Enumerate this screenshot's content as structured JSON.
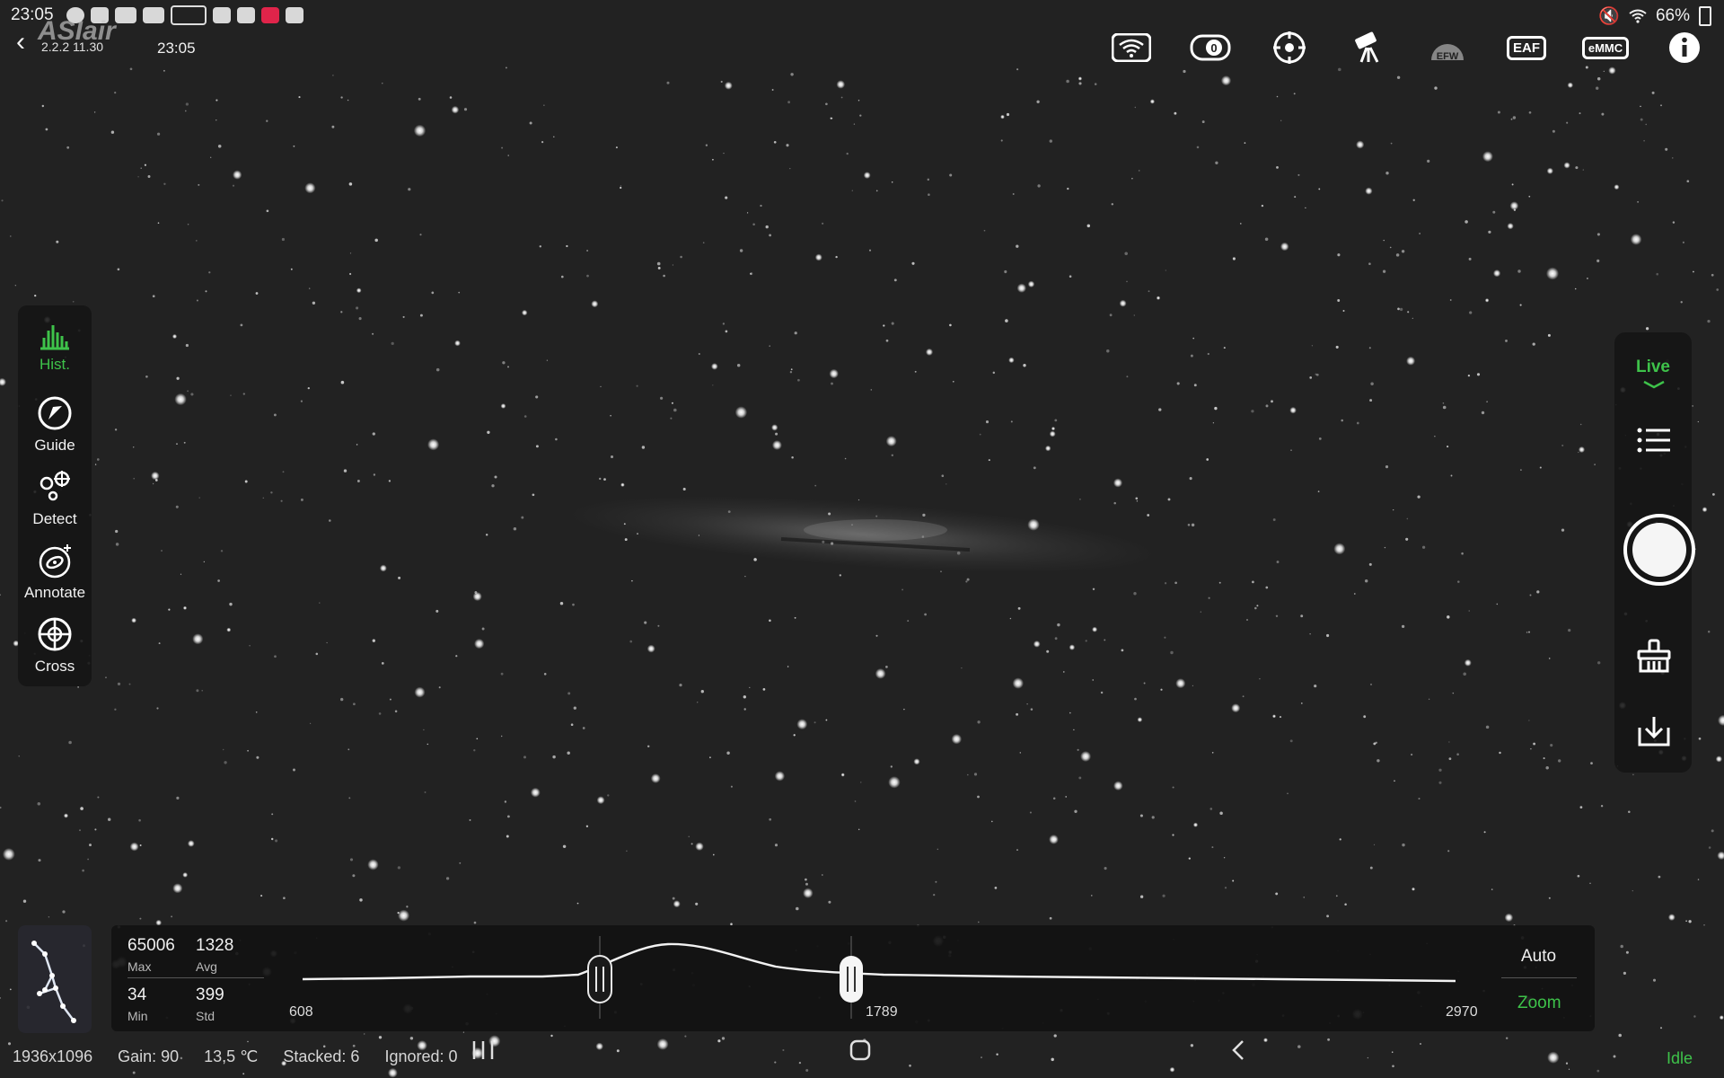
{
  "status_bar": {
    "time": "23:05",
    "battery": "66%"
  },
  "header": {
    "app_logo": "ASIair",
    "version": "2.2.2 11.30",
    "time": "23:05",
    "devices": [
      "wifi",
      "camera-0",
      "guide-scope",
      "telescope-mount",
      "EFW",
      "EAF",
      "eMMC",
      "info"
    ],
    "efw_label": "EFW",
    "eaf_label": "EAF",
    "emmc_label": "eMMC",
    "camera_index": "0"
  },
  "tools": {
    "hist": "Hist.",
    "guide": "Guide",
    "detect": "Detect",
    "annotate": "Annotate",
    "cross": "Cross"
  },
  "right_panel": {
    "mode": "Live"
  },
  "histogram": {
    "max_value": "65006",
    "max_label": "Max",
    "avg_value": "1328",
    "avg_label": "Avg",
    "min_value": "34",
    "min_label": "Min",
    "std_value": "399",
    "std_label": "Std",
    "left_mark": "608",
    "mid_mark": "1789",
    "right_mark": "2970",
    "auto_label": "Auto",
    "zoom_label": "Zoom"
  },
  "bottom_info": {
    "resolution": "1936x1096",
    "gain": "Gain: 90",
    "temperature": "13,5 ℃",
    "stacked": "Stacked: 6",
    "ignored": "Ignored: 0",
    "state": "Idle"
  },
  "colors": {
    "accent": "#3ec24a",
    "panel_bg": "#141414",
    "sky_bg": "#232323"
  }
}
